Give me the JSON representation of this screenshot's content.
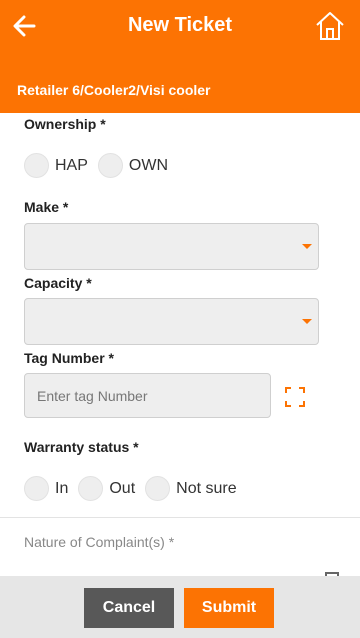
{
  "header": {
    "title": "New Ticket",
    "breadcrumb": "Retailer 6/Cooler2/Visi cooler",
    "back_icon": "arrow-left-icon",
    "home_icon": "home-icon",
    "accent_color": "#fc7303"
  },
  "form": {
    "ownership": {
      "label": "Ownership *",
      "options": [
        "HAP",
        "OWN"
      ]
    },
    "make": {
      "label": "Make *",
      "value": ""
    },
    "capacity": {
      "label": "Capacity *",
      "value": ""
    },
    "tag_number": {
      "label": "Tag Number *",
      "placeholder": "Enter tag Number",
      "value": "",
      "scan_icon": "scan-icon"
    },
    "warranty": {
      "label": "Warranty status *",
      "options": [
        "In",
        "Out",
        "Not sure"
      ]
    },
    "complaint": {
      "label": "Nature of Complaint(s) *"
    }
  },
  "actions": {
    "cancel_label": "Cancel",
    "submit_label": "Submit"
  }
}
